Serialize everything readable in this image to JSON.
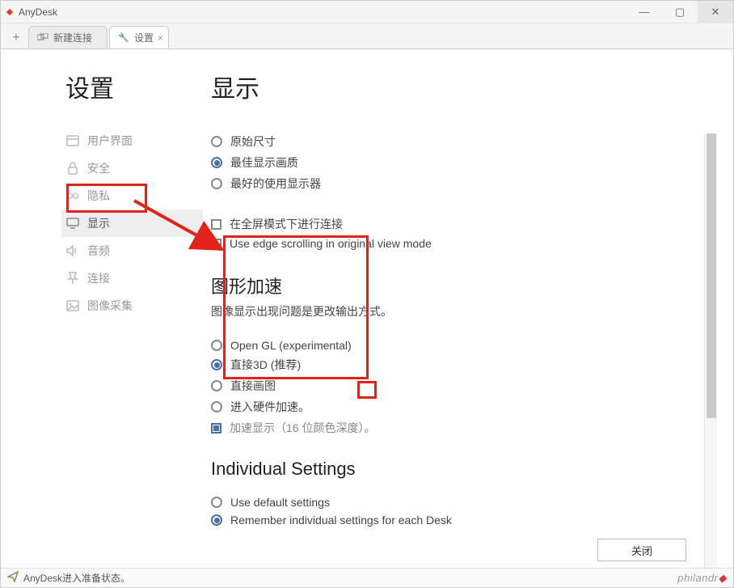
{
  "window": {
    "title": "AnyDesk"
  },
  "window_controls": {
    "min_glyph": "—",
    "max_glyph": "▢",
    "close_glyph": "✕"
  },
  "tabs": {
    "add_glyph": "+",
    "wrench_glyph": "🔧",
    "items": [
      {
        "label": "新建连接",
        "closeable": false
      },
      {
        "label": "设置",
        "closeable": true
      }
    ],
    "close_glyph": "×"
  },
  "sidebar": {
    "title": "设置",
    "items": [
      {
        "label": "用户界面",
        "icon": "layout"
      },
      {
        "label": "安全",
        "icon": "lock"
      },
      {
        "label": "隐私",
        "icon": "glasses"
      },
      {
        "label": "显示",
        "icon": "monitor",
        "active": true
      },
      {
        "label": "音频",
        "icon": "speaker"
      },
      {
        "label": "连接",
        "icon": "pin"
      },
      {
        "label": "图像采集",
        "icon": "image"
      }
    ]
  },
  "main": {
    "title": "显示",
    "size_mode": {
      "options": [
        {
          "label": "原始尺寸",
          "checked": false
        },
        {
          "label": "最佳显示画质",
          "checked": true
        },
        {
          "label": "最好的使用显示器",
          "checked": false
        }
      ]
    },
    "fullscreen_checks": [
      {
        "label": "在全屏模式下进行连接",
        "checked": false
      },
      {
        "label": "Use edge scrolling in original view mode",
        "checked": false
      }
    ],
    "gfx": {
      "heading": "图形加速",
      "subtitle": "图像显示出现问题是更改输出方式。",
      "options": [
        {
          "label": "Open GL (experimental)",
          "checked": false
        },
        {
          "label": "直接3D (推荐)",
          "checked": true
        },
        {
          "label": "直接画图",
          "checked": false
        },
        {
          "label": "进入硬件加速。",
          "checked": false
        }
      ],
      "accelerated_display_label": "加速显示（16 位颜色深度）。"
    },
    "individual": {
      "heading": "Individual Settings",
      "options": [
        {
          "label": "Use default settings",
          "checked": false
        },
        {
          "label": "Remember individual settings for each Desk",
          "checked": true
        }
      ]
    },
    "close_button": "关闭"
  },
  "status": {
    "text": "AnyDesk进入准备状态。"
  },
  "brand": {
    "text": "philandr",
    "dot": "◆"
  }
}
